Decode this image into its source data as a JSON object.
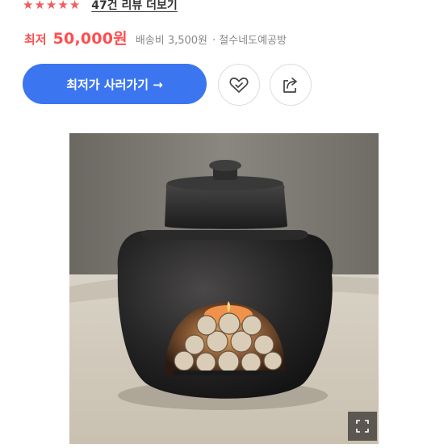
{
  "rating": {
    "stars": 5,
    "review_link": "47건 리뷰 더보기"
  },
  "price": {
    "label": "최저",
    "value": "50,000원",
    "shipping": "배송비 3,500원",
    "seller": "· 철수네도예공방"
  },
  "buttons": {
    "buy_label": "최저가 사러가기 →",
    "wishlist_icon": "heart-check-icon",
    "share_icon": "share-icon",
    "expand_icon": "expand-icon"
  },
  "colors": {
    "accent_red": "#ff4d4f",
    "star_red": "#f25b5b",
    "button_blue": "#3b76f0"
  }
}
